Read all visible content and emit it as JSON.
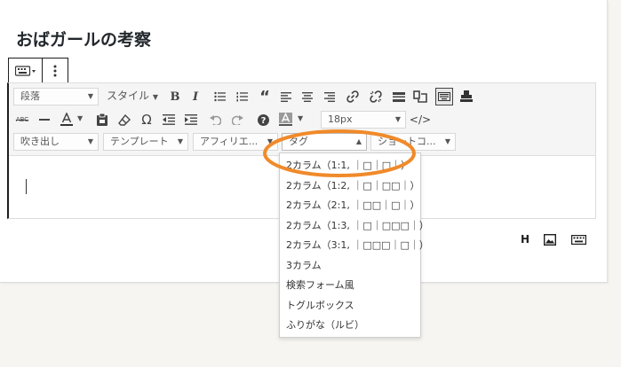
{
  "page": {
    "title": "おばガールの考察"
  },
  "toolbar": {
    "row1": {
      "paragraph_select": "段落",
      "style_dropdown": "スタイル",
      "bold": "B",
      "italic": "I"
    },
    "row2": {
      "omega": "Ω",
      "font_size_select": "18px"
    },
    "row3": {
      "speech_bubble_select": "吹き出し",
      "template_select": "テンプレート",
      "affiliate_select": "アフィリエ...",
      "tag_select": "タグ",
      "shortcode_select": "ショートコ..."
    }
  },
  "tag_menu": {
    "items": [
      "2カラム（1:1, ｜□｜□｜）",
      "2カラム（1:2, ｜□｜□□｜）",
      "2カラム（2:1, ｜□□｜□｜）",
      "2カラム（1:3, ｜□｜□□□｜）",
      "2カラム（3:1, ｜□□□｜□｜）",
      "3カラム",
      "検索フォーム風",
      "トグルボックス",
      "ふりがな（ルビ）"
    ]
  },
  "bottom_bar": {
    "heading_label": "H"
  },
  "colors": {
    "highlight": "#f08a2a",
    "page_bg": "#f6f5f1",
    "toolbar_bg": "#f5f5f5"
  },
  "icons": {
    "block_toolbar": [
      "keyboard-icon",
      "more-vertical-icon"
    ],
    "bottom": [
      "heading-icon",
      "image-icon",
      "keyboard-icon"
    ]
  }
}
